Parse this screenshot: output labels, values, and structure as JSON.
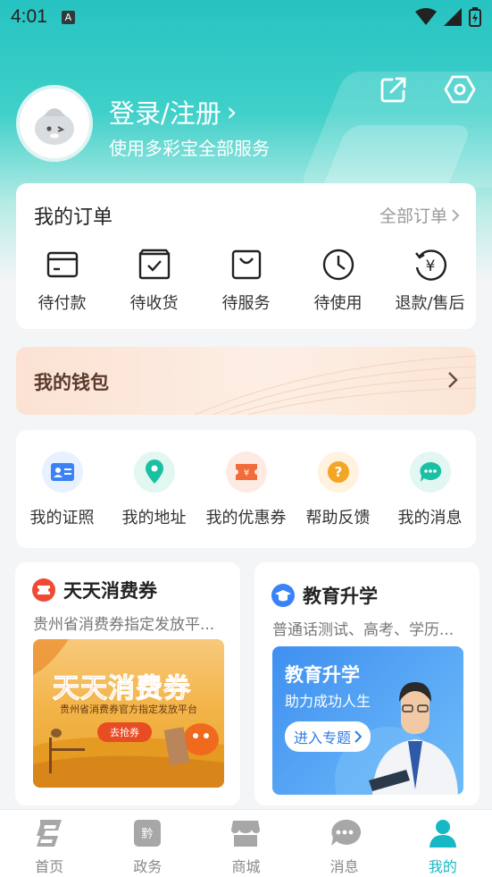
{
  "status_bar": {
    "time": "4:01",
    "app_badge": "A"
  },
  "header": {
    "login_label": "登录/注册",
    "login_chevron": "›",
    "subtitle": "使用多彩宝全部服务",
    "icons": [
      "share-icon",
      "settings-icon"
    ]
  },
  "orders": {
    "title": "我的订单",
    "all_label": "全部订单",
    "items": [
      {
        "label": "待付款",
        "icon": "wallet-card-icon"
      },
      {
        "label": "待收货",
        "icon": "box-check-icon"
      },
      {
        "label": "待服务",
        "icon": "bag-icon"
      },
      {
        "label": "待使用",
        "icon": "clock-icon"
      },
      {
        "label": "退款/售后",
        "icon": "yen-refund-icon"
      }
    ]
  },
  "wallet": {
    "label": "我的钱包"
  },
  "tools": {
    "items": [
      {
        "label": "我的证照",
        "icon": "id-card-icon",
        "color": "#3b82f6",
        "bg": "#e8f1ff"
      },
      {
        "label": "我的地址",
        "icon": "location-pin-icon",
        "color": "#19c0a4",
        "bg": "#e3f7f2"
      },
      {
        "label": "我的优惠券",
        "icon": "coupon-icon",
        "color": "#f26b3a",
        "bg": "#fdebe3"
      },
      {
        "label": "帮助反馈",
        "icon": "question-icon",
        "color": "#f5a524",
        "bg": "#fff3e0"
      },
      {
        "label": "我的消息",
        "icon": "chat-icon",
        "color": "#19c0a4",
        "bg": "#e3f7f2"
      }
    ]
  },
  "promos": {
    "coupon": {
      "title": "天天消费券",
      "subtitle": "贵州省消费券指定发放平...",
      "banner_title": "天天消费券",
      "banner_sub": "贵州省消费券官方指定发放平台",
      "banner_button": "去抢券"
    },
    "education": {
      "title": "教育升学",
      "subtitle": "普通话测试、高考、学历...",
      "banner_title": "教育升学",
      "banner_sub": "助力成功人生",
      "banner_button": "进入专题"
    }
  },
  "tabbar": {
    "items": [
      {
        "label": "首页",
        "icon": "home-icon"
      },
      {
        "label": "政务",
        "icon": "government-icon"
      },
      {
        "label": "商城",
        "icon": "store-icon"
      },
      {
        "label": "消息",
        "icon": "message-icon"
      },
      {
        "label": "我的",
        "icon": "profile-icon"
      }
    ],
    "active_index": 4,
    "active_color": "#15b8c4"
  },
  "colors": {
    "brand": "#27c3c2",
    "accent": "#15b8c4"
  }
}
